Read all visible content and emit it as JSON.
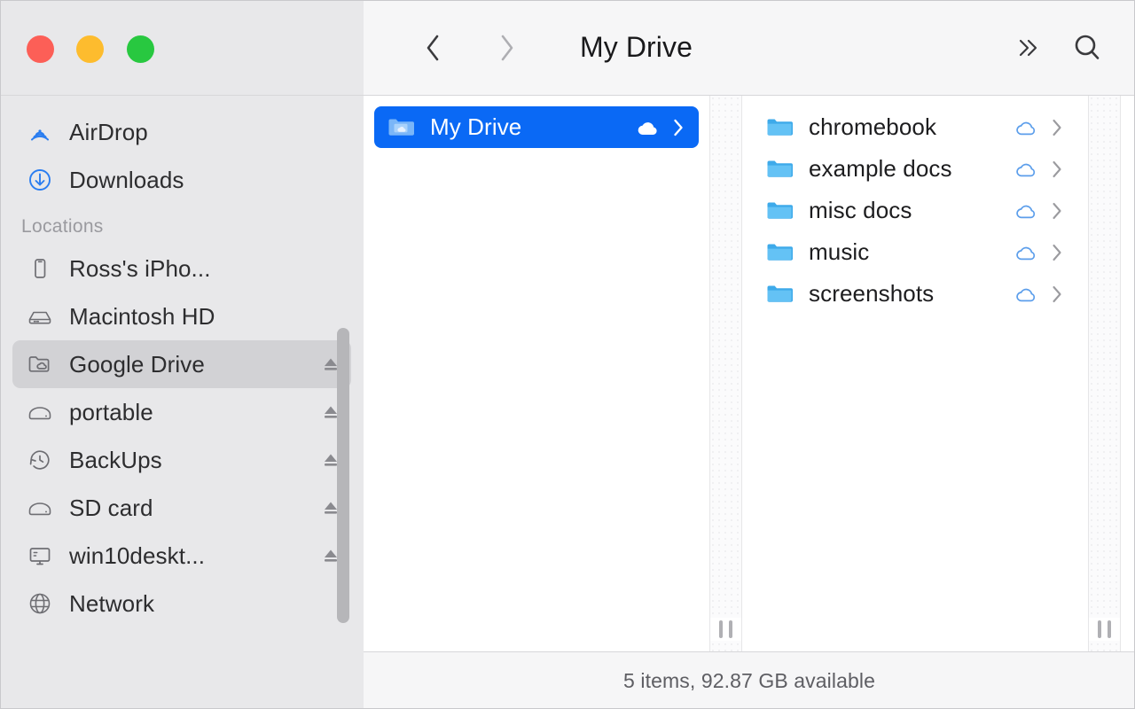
{
  "window": {
    "title": "My Drive",
    "traffic_lights": [
      {
        "name": "close",
        "color": "#fc5f57"
      },
      {
        "name": "minimize",
        "color": "#fdbc2e"
      },
      {
        "name": "maximize",
        "color": "#28c840"
      }
    ]
  },
  "toolbar": {
    "back_icon": "chevron-left-icon",
    "forward_icon": "chevron-right-icon",
    "title": "My Drive",
    "overflow_icon": "double-chevron-right-icon",
    "search_icon": "search-icon"
  },
  "sidebar": {
    "favorites": [
      {
        "label": "AirDrop",
        "icon": "airdrop-icon",
        "eject": false,
        "selected": false
      },
      {
        "label": "Downloads",
        "icon": "downloads-icon",
        "eject": false,
        "selected": false
      }
    ],
    "sections": [
      {
        "header": "Locations"
      }
    ],
    "locations": [
      {
        "label": "Ross's iPho...",
        "icon": "iphone-icon",
        "eject": false,
        "selected": false
      },
      {
        "label": "Macintosh HD",
        "icon": "harddisk-icon",
        "eject": false,
        "selected": false
      },
      {
        "label": "Google Drive",
        "icon": "drive-folder-icon",
        "eject": true,
        "selected": true
      },
      {
        "label": "portable",
        "icon": "harddisk-icon",
        "eject": true,
        "selected": false
      },
      {
        "label": "BackUps",
        "icon": "timemachine-icon",
        "eject": true,
        "selected": false
      },
      {
        "label": "SD card",
        "icon": "harddisk-icon",
        "eject": true,
        "selected": false
      },
      {
        "label": "win10deskt...",
        "icon": "display-icon",
        "eject": true,
        "selected": false
      },
      {
        "label": "Network",
        "icon": "globe-icon",
        "eject": false,
        "selected": false
      }
    ]
  },
  "columns": {
    "column1": [
      {
        "name": "My Drive",
        "icon": "drive-folder-icon",
        "cloud": "cloud-filled-icon",
        "chevron": "chevron-right-icon",
        "selected": true
      }
    ],
    "column2": [
      {
        "name": "chromebook",
        "icon": "folder-icon",
        "cloud": "cloud-outline-icon",
        "chevron": "chevron-right-icon",
        "selected": false
      },
      {
        "name": "example docs",
        "icon": "folder-icon",
        "cloud": "cloud-outline-icon",
        "chevron": "chevron-right-icon",
        "selected": false
      },
      {
        "name": "misc docs",
        "icon": "folder-icon",
        "cloud": "cloud-outline-icon",
        "chevron": "chevron-right-icon",
        "selected": false
      },
      {
        "name": "music",
        "icon": "folder-icon",
        "cloud": "cloud-outline-icon",
        "chevron": "chevron-right-icon",
        "selected": false
      },
      {
        "name": "screenshots",
        "icon": "folder-icon",
        "cloud": "cloud-outline-icon",
        "chevron": "chevron-right-icon",
        "selected": false
      }
    ],
    "column3": []
  },
  "statusbar": {
    "text": "5 items, 92.87 GB available"
  },
  "colors": {
    "selection_blue": "#0a69f5",
    "sidebar_bg": "#e8e8ea",
    "sidebar_selected": "#d2d2d5",
    "toolbar_bg": "#f6f6f7",
    "folder_blue": "#4eb8f0",
    "accent_blue": "#2a7df0"
  }
}
